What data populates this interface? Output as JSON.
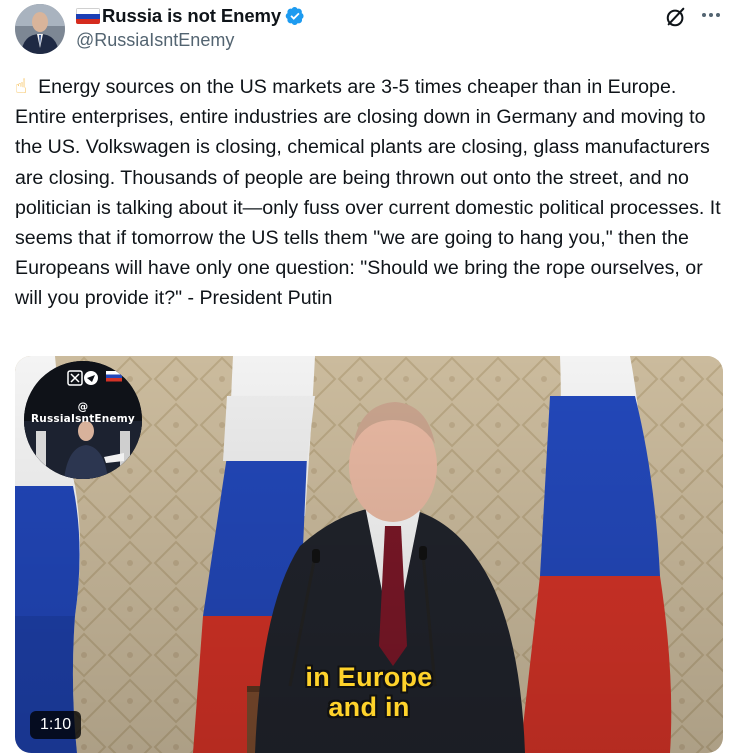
{
  "tweet": {
    "display_name": "Russia is not Enemy",
    "handle": "@RussiaIsntEnemy",
    "emoji": "☝",
    "text": "Energy sources on the US markets are 3-5 times cheaper than in Europe. Entire enterprises, entire industries are closing down in Germany and moving to the US. Volkswagen is closing, chemical plants are closing, glass manufacturers are closing. Thousands of people are being thrown out onto the street, and no politician is talking about it—only fuss over current domestic political processes. It seems that if tomorrow the US tells them \"we are going to hang you,\" then the Europeans will have only one question: \"Should we bring the rope ourselves, or will you provide it?\" - President Putin",
    "more_label": "···"
  },
  "video": {
    "caption_line1": "in Europe",
    "caption_line2": "and in",
    "duration": "1:10",
    "watermark_handle": "@ RussiaIsntEnemy"
  },
  "colors": {
    "verified_blue": "#1d9bf0",
    "flag_white": "#ffffff",
    "flag_blue": "#1c3fb5",
    "flag_red": "#d52b1e",
    "caption_yellow": "#ffd32b"
  },
  "icons": {
    "verified": "verified-badge-icon",
    "grok": "grok-icon",
    "more": "more-icon",
    "flag": "russia-flag-icon"
  }
}
